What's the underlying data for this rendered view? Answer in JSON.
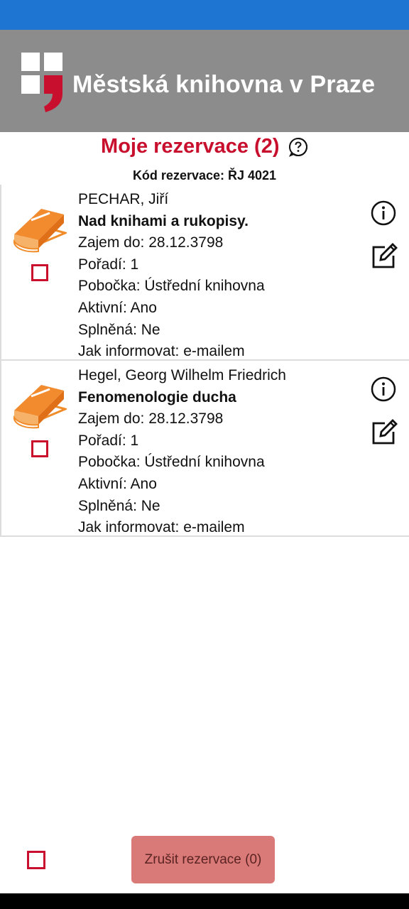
{
  "header": {
    "logo_text": "Městská knihovna v Praze",
    "background": "#8c8c8c",
    "statusbar_color": "#1f76d2"
  },
  "page": {
    "title": "Moje rezervace (2)",
    "code_label": "Kód rezervace: ŘJ 4021",
    "accent": "#c8102e"
  },
  "items": [
    {
      "author": "PECHAR, Jiří",
      "title": "Nad knihami a rukopisy.",
      "zajem": "Zajem do: 28.12.3798",
      "poradi": "Pořadí: 1",
      "pobocka": "Pobočka: Ústřední knihovna",
      "aktivni": "Aktivní: Ano",
      "splnena": "Splněná: Ne",
      "informovat": "Jak informovat: e-mailem"
    },
    {
      "author": "Hegel, Georg Wilhelm Friedrich",
      "title": "Fenomenologie ducha",
      "zajem": "Zajem do: 28.12.3798",
      "poradi": "Pořadí: 1",
      "pobocka": "Pobočka: Ústřední knihovna",
      "aktivni": "Aktivní: Ano",
      "splnena": "Splněná: Ne",
      "informovat": "Jak informovat: e-mailem"
    }
  ],
  "footer": {
    "cancel_label": "Zrušit rezervace (0)"
  },
  "icons": {
    "book": "book-icon",
    "info": "info-icon",
    "edit": "edit-icon",
    "help": "help-icon"
  }
}
